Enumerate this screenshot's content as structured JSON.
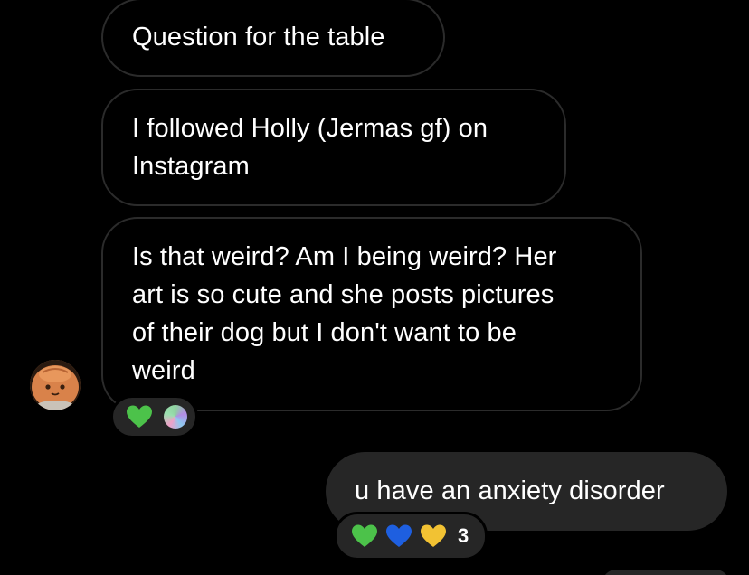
{
  "messages": [
    {
      "sender": "other",
      "lines": [
        "Question for the table"
      ]
    },
    {
      "sender": "other",
      "lines": [
        "I followed Holly (Jermas gf) on",
        "Instagram"
      ]
    },
    {
      "sender": "other",
      "lines": [
        "Is that weird? Am I being weird? Her",
        "art is so cute and she posts pictures",
        "of their dog but I don't want to be",
        "weird"
      ],
      "reactions": [
        "green-heart",
        "iridescent-orb"
      ]
    },
    {
      "sender": "me",
      "lines": [
        "u have an anxiety disorder"
      ],
      "reactions": [
        "green-heart",
        "blue-heart",
        "yellow-heart"
      ],
      "reaction_count": "3"
    }
  ],
  "colors": {
    "background": "#000000",
    "incoming_border": "#2b2b2b",
    "outgoing_bubble": "#262626",
    "green_heart": "#4cc24a",
    "blue_heart": "#1e5fe0",
    "yellow_heart": "#f2c233"
  }
}
